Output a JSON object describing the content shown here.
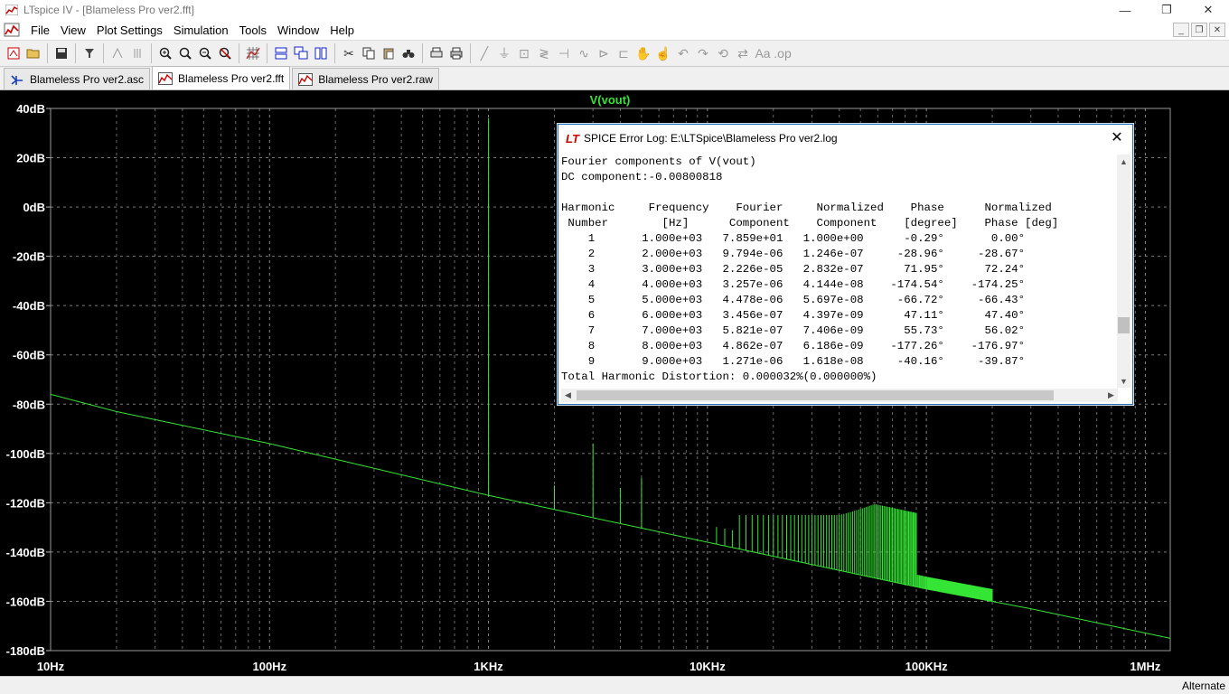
{
  "window": {
    "title": "LTspice IV - [Blameless Pro ver2.fft]",
    "controls": [
      "—",
      "❐",
      "✕"
    ]
  },
  "menu": {
    "items": [
      "File",
      "View",
      "Plot Settings",
      "Simulation",
      "Tools",
      "Window",
      "Help"
    ],
    "mdi_controls": [
      "_",
      "❐",
      "✕"
    ]
  },
  "toolbar": {
    "buttons": [
      "new-schematic-icon",
      "open-icon",
      "save-icon",
      "control-panel-icon",
      "run-icon",
      "halt-icon",
      "zoom-in-icon",
      "zoom-out-icon",
      "zoom-full-icon",
      "cancel-zoom-icon",
      "autorange-icon",
      "tile-horizontal-icon",
      "cascade-icon",
      "tile-vertical-icon",
      "cut-icon",
      "copy-icon",
      "paste-icon",
      "find-icon",
      "print-preview-icon",
      "print-icon",
      "wire-icon",
      "ground-icon",
      "label-icon",
      "resistor-icon",
      "capacitor-icon",
      "inductor-icon",
      "diode-icon",
      "component-icon",
      "move-icon",
      "drag-icon",
      "undo-icon",
      "redo-icon",
      "rotate-icon",
      "mirror-icon",
      "text-icon",
      "spice-directive-icon"
    ]
  },
  "tabs": [
    {
      "label": "Blameless Pro ver2.asc",
      "icon": "schematic-icon",
      "active": false
    },
    {
      "label": "Blameless Pro ver2.fft",
      "icon": "waveform-icon",
      "active": true
    },
    {
      "label": "Blameless Pro ver2.raw",
      "icon": "waveform-icon",
      "active": false
    }
  ],
  "plot": {
    "trace_label": "V(vout)",
    "trace_color": "#35e535",
    "y_ticks": [
      "40dB",
      "20dB",
      "0dB",
      "-20dB",
      "-40dB",
      "-60dB",
      "-80dB",
      "-100dB",
      "-120dB",
      "-140dB",
      "-160dB",
      "-180dB"
    ],
    "x_ticks": [
      "10Hz",
      "100Hz",
      "1KHz",
      "10KHz",
      "100KHz",
      "1MHz"
    ]
  },
  "chart_data": {
    "type": "line",
    "title": "V(vout)",
    "x_scale": "log",
    "xlim": [
      10,
      1300000
    ],
    "ylim": [
      -180,
      40
    ],
    "grid": true,
    "x_unit": "Hz",
    "y_unit": "dB",
    "series": [
      {
        "name": "V(vout)",
        "noise_floor": {
          "x": [
            10,
            20,
            100,
            1000,
            10000,
            100000,
            300000,
            1300000
          ],
          "y": [
            -76,
            -83,
            -96,
            -117,
            -136,
            -155,
            -163,
            -175
          ]
        },
        "spikes": {
          "x": [
            1000,
            2000,
            3000,
            4000,
            5000
          ],
          "y": [
            36,
            -113,
            -96,
            -114,
            -110
          ]
        }
      }
    ]
  },
  "dialog": {
    "title": "SPICE Error Log: E:\\LTSpice\\Blameless Pro ver2.log",
    "close": "✕",
    "lines": [
      "Fourier components of V(vout)",
      "DC component:-0.00800818",
      "",
      "Harmonic     Frequency    Fourier     Normalized    Phase      Normalized",
      " Number        [Hz]      Component    Component    [degree]    Phase [deg]",
      "    1       1.000e+03   7.859e+01   1.000e+00      -0.29°       0.00°",
      "    2       2.000e+03   9.794e-06   1.246e-07     -28.96°     -28.67°",
      "    3       3.000e+03   2.226e-05   2.832e-07      71.95°      72.24°",
      "    4       4.000e+03   3.257e-06   4.144e-08    -174.54°    -174.25°",
      "    5       5.000e+03   4.478e-06   5.697e-08     -66.72°     -66.43°",
      "    6       6.000e+03   3.456e-07   4.397e-09      47.11°      47.40°",
      "    7       7.000e+03   5.821e-07   7.406e-09      55.73°      56.02°",
      "    8       8.000e+03   4.862e-07   6.186e-09    -177.26°    -176.97°",
      "    9       9.000e+03   1.271e-06   1.618e-08     -40.16°     -39.87°",
      "Total Harmonic Distortion: 0.000032%(0.000000%)"
    ]
  },
  "status": {
    "text": "Alternate"
  }
}
